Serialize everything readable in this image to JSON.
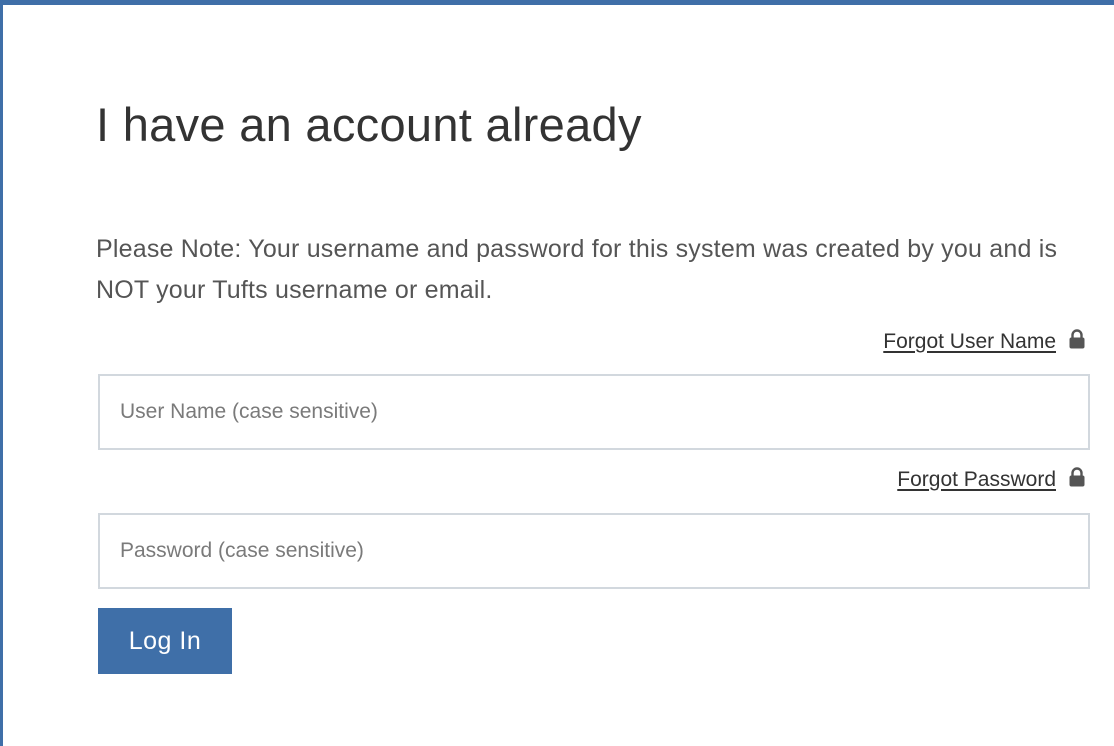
{
  "heading": "I have an account already",
  "note": "Please Note: Your username and password for this system was created by you and is NOT your Tufts username or email.",
  "forgot_user": {
    "label": "Forgot User Name",
    "icon": "lock-icon"
  },
  "forgot_password": {
    "label": "Forgot Password",
    "icon": "lock-icon"
  },
  "username_field": {
    "placeholder": "User Name (case sensitive)",
    "value": ""
  },
  "password_field": {
    "placeholder": "Password (case sensitive)",
    "value": ""
  },
  "login_button": {
    "label": "Log In"
  },
  "colors": {
    "accent": "#3f6fa8",
    "input_border": "#d2d8de",
    "heading_text": "#333333",
    "body_text": "#555555"
  }
}
